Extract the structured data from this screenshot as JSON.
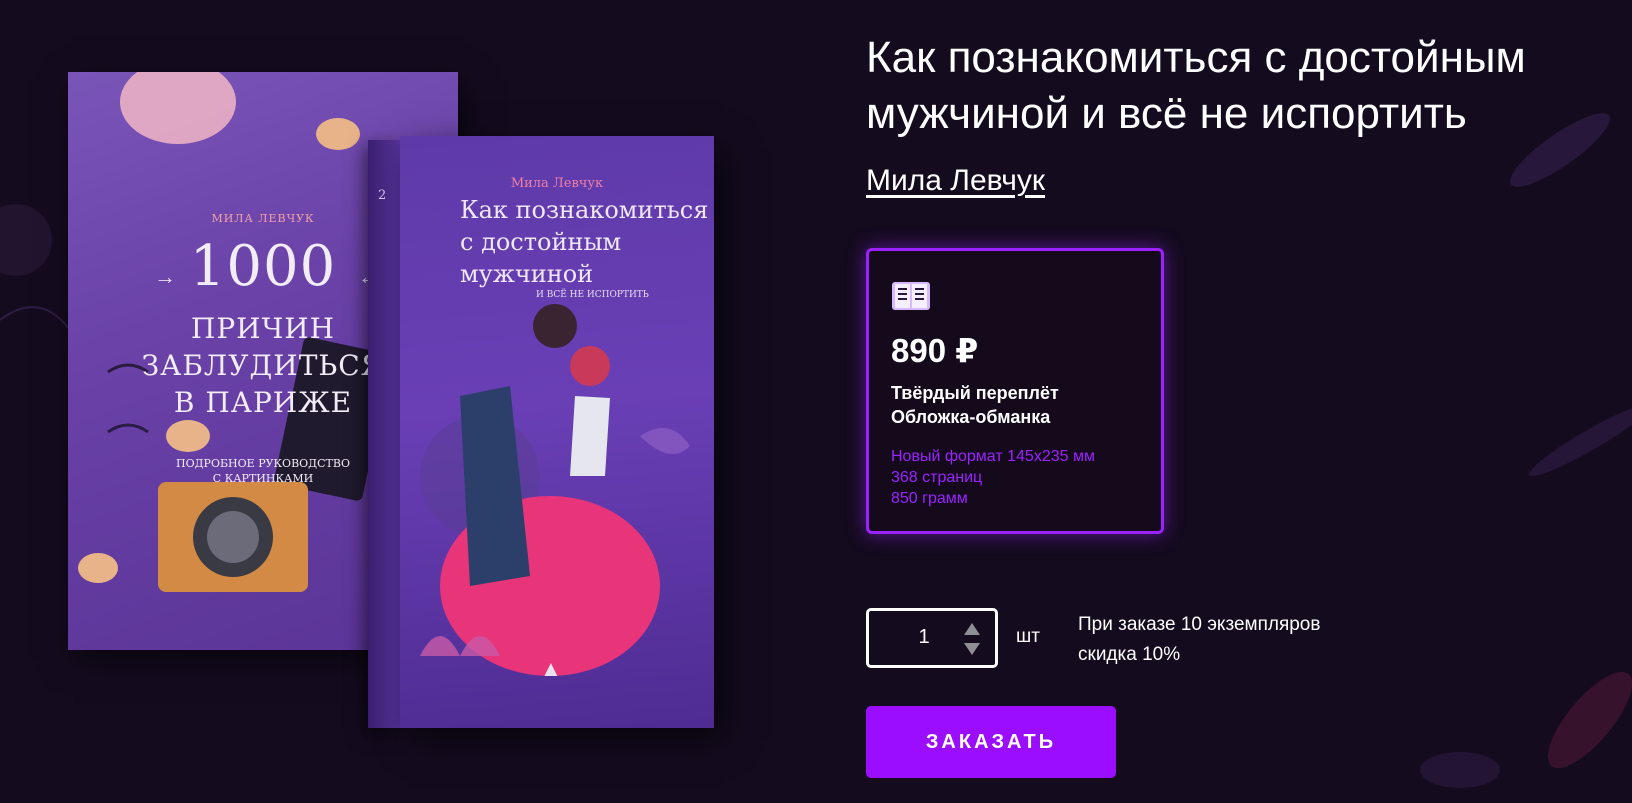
{
  "product": {
    "title": "Как познакомиться с достойным мужчиной и всё не испортить",
    "author": "Мила Левчук"
  },
  "offer": {
    "icon": "open-book-icon",
    "price": "890 ₽",
    "binding_line1": "Твёрдый переплёт",
    "binding_line2": "Обложка-обманка",
    "spec_format": "Новый формат 145x235 мм",
    "spec_pages": "368 страниц",
    "spec_weight": "850 грамм"
  },
  "order": {
    "quantity": "1",
    "unit": "шт",
    "discount_line1": "При заказе 10 экземпляров",
    "discount_line2": "скидка 10%",
    "button_label": "ЗАКАЗАТЬ"
  },
  "covers": {
    "back": {
      "author": "МИЛА ЛЕВЧУК",
      "number": "1000",
      "title_line1": "ПРИЧИН",
      "title_line2": "ЗАБЛУДИТЬСЯ",
      "title_line3": "В ПАРИЖЕ",
      "subtitle_line1": "ПОДРОБНОЕ РУКОВОДСТВО",
      "subtitle_line2": "С КАРТИНКАМИ"
    },
    "front": {
      "author": "Мила Левчук",
      "title_line1": "Как познакомиться",
      "title_line2": "с достойным",
      "title_line3": "мужчиной",
      "tagline": "И ВСЁ НЕ ИСПОРТИТЬ",
      "spine_number": "2"
    }
  },
  "colors": {
    "background": "#150b1f",
    "accent": "#9b0dff",
    "card_border": "#9b22ff",
    "text": "#ffffff"
  }
}
